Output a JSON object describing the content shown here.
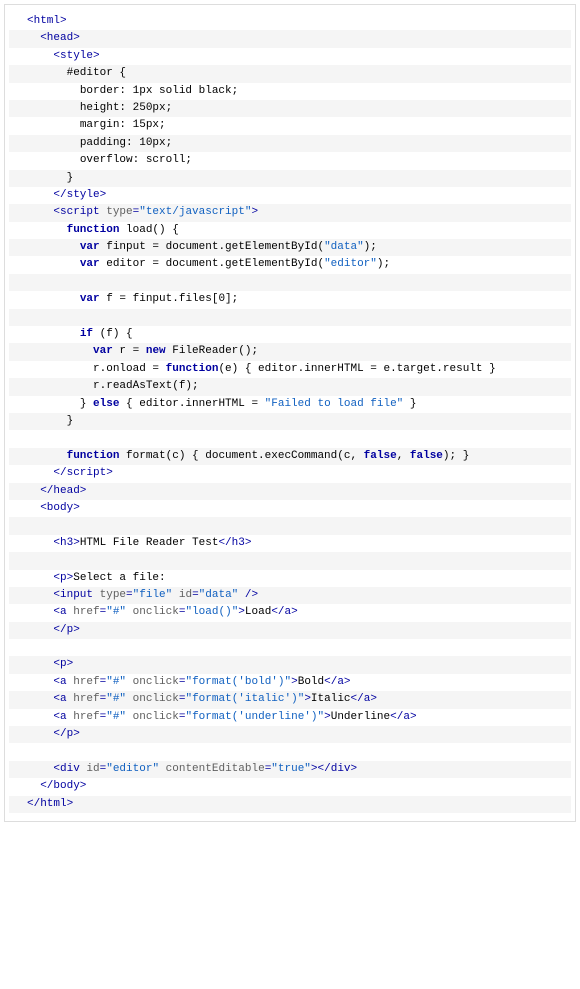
{
  "lines": [
    {
      "indent": 0,
      "segs": [
        [
          "tag",
          "<html>"
        ]
      ]
    },
    {
      "indent": 1,
      "segs": [
        [
          "tag",
          "<head>"
        ]
      ]
    },
    {
      "indent": 2,
      "segs": [
        [
          "tag",
          "<style>"
        ]
      ]
    },
    {
      "indent": 3,
      "segs": [
        [
          "plain",
          "#editor {"
        ]
      ]
    },
    {
      "indent": 4,
      "segs": [
        [
          "plain",
          "border: 1px solid black;"
        ]
      ]
    },
    {
      "indent": 4,
      "segs": [
        [
          "plain",
          "height: 250px;"
        ]
      ]
    },
    {
      "indent": 4,
      "segs": [
        [
          "plain",
          "margin: 15px;"
        ]
      ]
    },
    {
      "indent": 4,
      "segs": [
        [
          "plain",
          "padding: 10px;"
        ]
      ]
    },
    {
      "indent": 4,
      "segs": [
        [
          "plain",
          "overflow: scroll;"
        ]
      ]
    },
    {
      "indent": 3,
      "segs": [
        [
          "plain",
          "}"
        ]
      ]
    },
    {
      "indent": 2,
      "segs": [
        [
          "tag",
          "</style>"
        ]
      ]
    },
    {
      "indent": 2,
      "segs": [
        [
          "tag",
          "<script "
        ],
        [
          "attr",
          "type"
        ],
        [
          "tag",
          "="
        ],
        [
          "str",
          "\"text/javascript\""
        ],
        [
          "tag",
          ">"
        ]
      ]
    },
    {
      "indent": 3,
      "segs": [
        [
          "kw",
          "function"
        ],
        [
          "plain",
          " load() {"
        ]
      ]
    },
    {
      "indent": 4,
      "segs": [
        [
          "kw",
          "var"
        ],
        [
          "plain",
          " finput = document.getElementById("
        ],
        [
          "str",
          "\"data\""
        ],
        [
          "plain",
          ");"
        ]
      ]
    },
    {
      "indent": 4,
      "segs": [
        [
          "kw",
          "var"
        ],
        [
          "plain",
          " editor = document.getElementById("
        ],
        [
          "str",
          "\"editor\""
        ],
        [
          "plain",
          ");"
        ]
      ]
    },
    {
      "indent": 0,
      "segs": []
    },
    {
      "indent": 4,
      "segs": [
        [
          "kw",
          "var"
        ],
        [
          "plain",
          " f = finput.files[0];"
        ]
      ]
    },
    {
      "indent": 0,
      "segs": []
    },
    {
      "indent": 4,
      "segs": [
        [
          "kw",
          "if"
        ],
        [
          "plain",
          " (f) {"
        ]
      ]
    },
    {
      "indent": 5,
      "segs": [
        [
          "kw",
          "var"
        ],
        [
          "plain",
          " r = "
        ],
        [
          "kw",
          "new"
        ],
        [
          "plain",
          " FileReader();"
        ]
      ]
    },
    {
      "indent": 5,
      "segs": [
        [
          "plain",
          "r.onload = "
        ],
        [
          "kw",
          "function"
        ],
        [
          "plain",
          "(e) { editor.innerHTML = e.target.result }"
        ]
      ]
    },
    {
      "indent": 5,
      "segs": [
        [
          "plain",
          "r.readAsText(f);"
        ]
      ]
    },
    {
      "indent": 4,
      "segs": [
        [
          "plain",
          "} "
        ],
        [
          "kw",
          "else"
        ],
        [
          "plain",
          " { editor.innerHTML = "
        ],
        [
          "str",
          "\"Failed to load file\""
        ],
        [
          "plain",
          " }"
        ]
      ]
    },
    {
      "indent": 3,
      "segs": [
        [
          "plain",
          "}"
        ]
      ]
    },
    {
      "indent": 0,
      "segs": []
    },
    {
      "indent": 3,
      "segs": [
        [
          "kw",
          "function"
        ],
        [
          "plain",
          " format(c) { document.execCommand(c, "
        ],
        [
          "kw",
          "false"
        ],
        [
          "plain",
          ", "
        ],
        [
          "kw",
          "false"
        ],
        [
          "plain",
          "); }"
        ]
      ]
    },
    {
      "indent": 2,
      "segs": [
        [
          "tag",
          "</script"
        ],
        [
          "tag",
          ">"
        ]
      ]
    },
    {
      "indent": 1,
      "segs": [
        [
          "tag",
          "</head>"
        ]
      ]
    },
    {
      "indent": 1,
      "segs": [
        [
          "tag",
          "<body>"
        ]
      ]
    },
    {
      "indent": 0,
      "segs": []
    },
    {
      "indent": 2,
      "segs": [
        [
          "tag",
          "<h3>"
        ],
        [
          "plain",
          "HTML File Reader Test"
        ],
        [
          "tag",
          "</h3>"
        ]
      ]
    },
    {
      "indent": 0,
      "segs": []
    },
    {
      "indent": 2,
      "segs": [
        [
          "tag",
          "<p>"
        ],
        [
          "plain",
          "Select a file:"
        ]
      ]
    },
    {
      "indent": 2,
      "segs": [
        [
          "tag",
          "<input "
        ],
        [
          "attr",
          "type"
        ],
        [
          "tag",
          "="
        ],
        [
          "str",
          "\"file\""
        ],
        [
          "tag",
          " "
        ],
        [
          "attr",
          "id"
        ],
        [
          "tag",
          "="
        ],
        [
          "str",
          "\"data\""
        ],
        [
          "tag",
          " />"
        ]
      ]
    },
    {
      "indent": 2,
      "segs": [
        [
          "tag",
          "<a "
        ],
        [
          "attr",
          "href"
        ],
        [
          "tag",
          "="
        ],
        [
          "str",
          "\"#\""
        ],
        [
          "tag",
          " "
        ],
        [
          "attr",
          "onclick"
        ],
        [
          "tag",
          "="
        ],
        [
          "str",
          "\"load()\""
        ],
        [
          "tag",
          ">"
        ],
        [
          "plain",
          "Load"
        ],
        [
          "tag",
          "</a>"
        ]
      ]
    },
    {
      "indent": 2,
      "segs": [
        [
          "tag",
          "</p>"
        ]
      ]
    },
    {
      "indent": 0,
      "segs": []
    },
    {
      "indent": 2,
      "segs": [
        [
          "tag",
          "<p>"
        ]
      ]
    },
    {
      "indent": 2,
      "segs": [
        [
          "tag",
          "<a "
        ],
        [
          "attr",
          "href"
        ],
        [
          "tag",
          "="
        ],
        [
          "str",
          "\"#\""
        ],
        [
          "tag",
          " "
        ],
        [
          "attr",
          "onclick"
        ],
        [
          "tag",
          "="
        ],
        [
          "str",
          "\"format('bold')\""
        ],
        [
          "tag",
          ">"
        ],
        [
          "plain",
          "Bold"
        ],
        [
          "tag",
          "</a>"
        ]
      ]
    },
    {
      "indent": 2,
      "segs": [
        [
          "tag",
          "<a "
        ],
        [
          "attr",
          "href"
        ],
        [
          "tag",
          "="
        ],
        [
          "str",
          "\"#\""
        ],
        [
          "tag",
          " "
        ],
        [
          "attr",
          "onclick"
        ],
        [
          "tag",
          "="
        ],
        [
          "str",
          "\"format('italic')\""
        ],
        [
          "tag",
          ">"
        ],
        [
          "plain",
          "Italic"
        ],
        [
          "tag",
          "</a>"
        ]
      ]
    },
    {
      "indent": 2,
      "segs": [
        [
          "tag",
          "<a "
        ],
        [
          "attr",
          "href"
        ],
        [
          "tag",
          "="
        ],
        [
          "str",
          "\"#\""
        ],
        [
          "tag",
          " "
        ],
        [
          "attr",
          "onclick"
        ],
        [
          "tag",
          "="
        ],
        [
          "str",
          "\"format('underline')\""
        ],
        [
          "tag",
          ">"
        ],
        [
          "plain",
          "Underline"
        ],
        [
          "tag",
          "</a>"
        ]
      ]
    },
    {
      "indent": 2,
      "segs": [
        [
          "tag",
          "</p>"
        ]
      ]
    },
    {
      "indent": 0,
      "segs": []
    },
    {
      "indent": 2,
      "segs": [
        [
          "tag",
          "<div "
        ],
        [
          "attr",
          "id"
        ],
        [
          "tag",
          "="
        ],
        [
          "str",
          "\"editor\""
        ],
        [
          "tag",
          " "
        ],
        [
          "attr",
          "contentEditable"
        ],
        [
          "tag",
          "="
        ],
        [
          "str",
          "\"true\""
        ],
        [
          "tag",
          ">"
        ],
        [
          "tag",
          "</div>"
        ]
      ]
    },
    {
      "indent": 1,
      "segs": [
        [
          "tag",
          "</body>"
        ]
      ]
    },
    {
      "indent": 0,
      "segs": [
        [
          "tag",
          "</html>"
        ]
      ]
    }
  ],
  "indentUnit": "  "
}
